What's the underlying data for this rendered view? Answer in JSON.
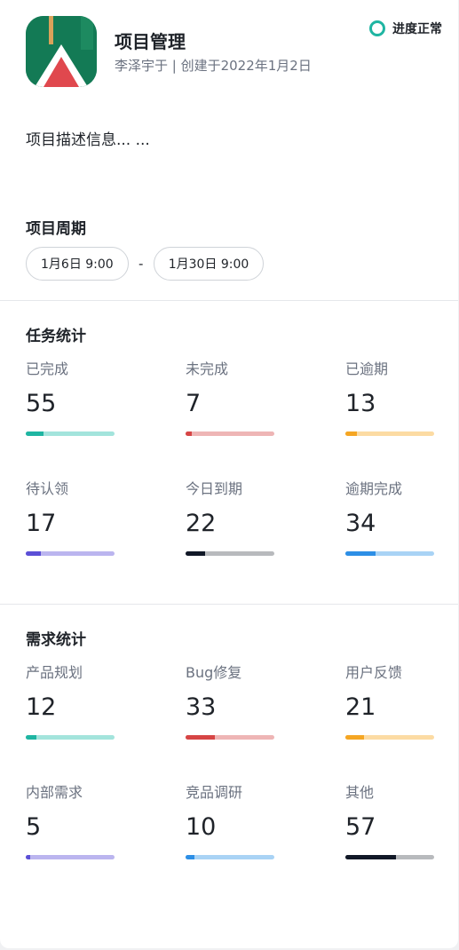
{
  "header": {
    "title": "项目管理",
    "subtitle": "李泽宇于 | 创建于2022年1月2日",
    "status_label": "进度正常",
    "status_color": "#1fb5a2"
  },
  "description": "项目描述信息... ...",
  "period": {
    "title": "项目周期",
    "start": "1月6日 9:00",
    "separator": "-",
    "end": "1月30日 9:00"
  },
  "task_stats": {
    "title": "任务统计",
    "items": [
      {
        "label": "已完成",
        "value": "55",
        "progress": 0.2,
        "color": "#1fb5a2",
        "track": "#a3e4dc"
      },
      {
        "label": "未完成",
        "value": "7",
        "progress": 0.07,
        "color": "#d64545",
        "track": "#eeb5b5"
      },
      {
        "label": "已逾期",
        "value": "13",
        "progress": 0.13,
        "color": "#f5a623",
        "track": "#fcdba3"
      },
      {
        "label": "待认领",
        "value": "17",
        "progress": 0.17,
        "color": "#5b4fd6",
        "track": "#bbb5ef"
      },
      {
        "label": "今日到期",
        "value": "22",
        "progress": 0.22,
        "color": "#111827",
        "track": "#b8babd"
      },
      {
        "label": "逾期完成",
        "value": "34",
        "progress": 0.34,
        "color": "#2d8fe6",
        "track": "#a9d3f5"
      }
    ]
  },
  "requirement_stats": {
    "title": "需求统计",
    "items": [
      {
        "label": "产品规划",
        "value": "12",
        "progress": 0.12,
        "color": "#1fb5a2",
        "track": "#a3e4dc"
      },
      {
        "label": "Bug修复",
        "value": "33",
        "progress": 0.33,
        "color": "#d64545",
        "track": "#eeb5b5"
      },
      {
        "label": "用户反馈",
        "value": "21",
        "progress": 0.21,
        "color": "#f5a623",
        "track": "#fcdba3"
      },
      {
        "label": "内部需求",
        "value": "5",
        "progress": 0.05,
        "color": "#5b4fd6",
        "track": "#bbb5ef"
      },
      {
        "label": "竞品调研",
        "value": "10",
        "progress": 0.1,
        "color": "#2d8fe6",
        "track": "#a9d3f5"
      },
      {
        "label": "其他",
        "value": "57",
        "progress": 0.57,
        "color": "#111827",
        "track": "#b8babd"
      }
    ]
  }
}
